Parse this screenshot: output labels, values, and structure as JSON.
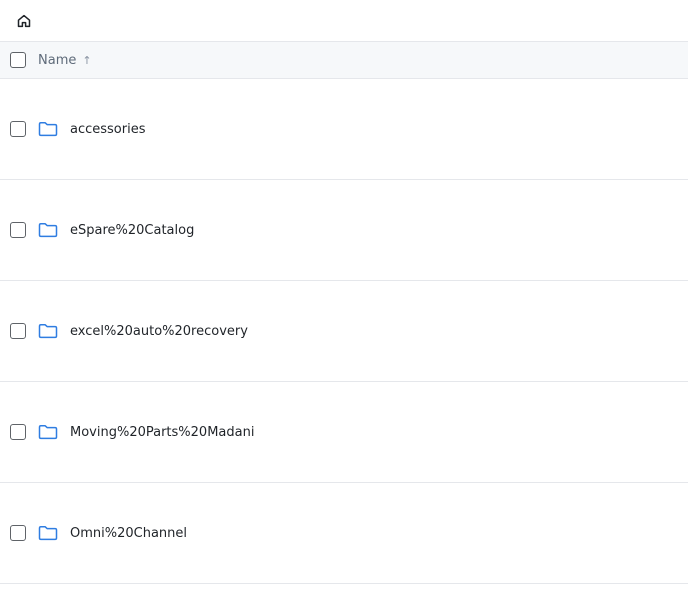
{
  "toolbar": {
    "home_icon": "home-icon"
  },
  "table": {
    "columns": [
      {
        "label": "Name",
        "sort": "ascending",
        "sort_glyph": "↑"
      }
    ],
    "rows": [
      {
        "label": "accessories",
        "icon": "folder-icon"
      },
      {
        "label": "eSpare%20Catalog",
        "icon": "folder-icon"
      },
      {
        "label": "excel%20auto%20recovery",
        "icon": "folder-icon"
      },
      {
        "label": "Moving%20Parts%20Madani",
        "icon": "folder-icon"
      },
      {
        "label": "Omni%20Channel",
        "icon": "folder-icon"
      }
    ]
  },
  "colors": {
    "folder_accent": "#2f7de1",
    "header_bg": "#f6f8fa",
    "divider": "#e5e7eb"
  }
}
